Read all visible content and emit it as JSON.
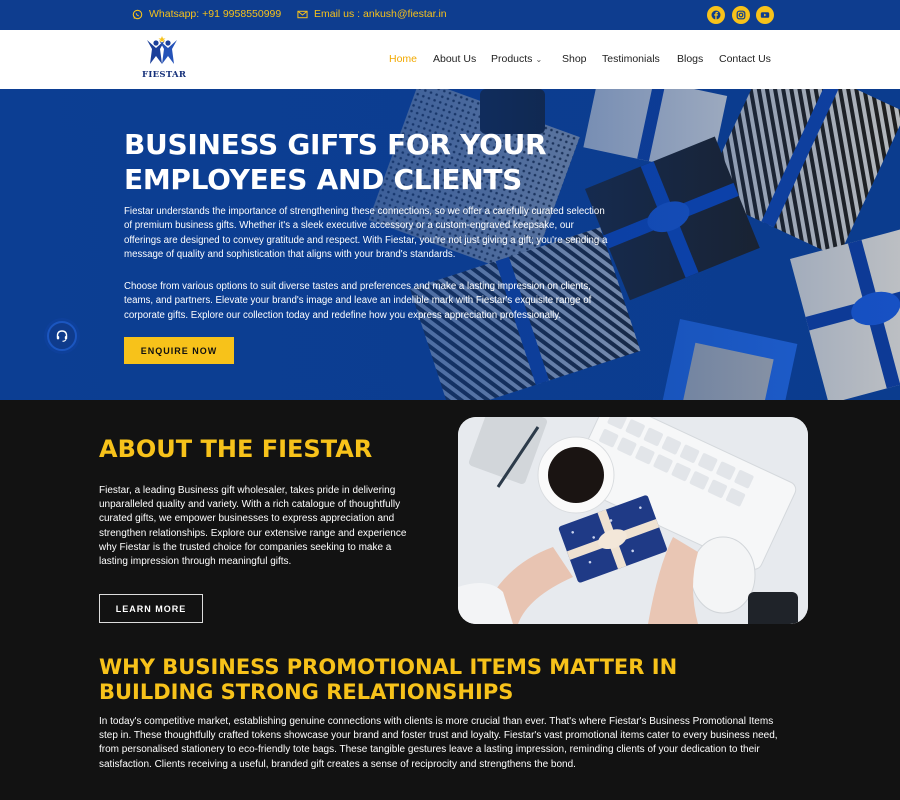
{
  "topbar": {
    "whatsapp": "Whatsapp: +91 9958550999",
    "email": "Email us : ankush@fiestar.in",
    "social_icons": [
      "facebook-icon",
      "instagram-icon",
      "youtube-icon"
    ]
  },
  "nav": {
    "logo_text": "FIESTAR",
    "items": [
      {
        "label": "Home",
        "active": true
      },
      {
        "label": "About Us"
      },
      {
        "label": "Products",
        "has_dropdown": true
      },
      {
        "label": "Shop"
      },
      {
        "label": "Testimonials"
      },
      {
        "label": "Blogs"
      },
      {
        "label": "Contact Us"
      }
    ]
  },
  "hero": {
    "title": "BUSINESS GIFTS FOR YOUR EMPLOYEES AND CLIENTS",
    "paragraph1": "Fiestar understands the importance of strengthening these connections, so we offer a carefully curated selection of premium business gifts. Whether it's a sleek executive accessory or a custom-engraved keepsake, our offerings are designed to convey gratitude and respect. With Fiestar, you're not just giving a gift; you're sending a message of quality and sophistication that aligns with your brand's standards.",
    "paragraph2": "Choose from various options to suit diverse tastes and preferences and make a lasting impression on clients, teams, and partners. Elevate your brand's image and leave an indelible mark with Fiestar's exquisite range of corporate gifts. Explore our collection today and redefine how you express appreciation professionally.",
    "cta": "ENQUIRE NOW"
  },
  "about": {
    "title": "ABOUT THE FIESTAR",
    "paragraph": "Fiestar, a leading Business gift wholesaler, takes pride in delivering unparalleled quality and variety. With a rich catalogue of thoughtfully curated gifts, we empower businesses to express appreciation and strengthen relationships. Explore our extensive range and experience why Fiestar is the trusted choice for companies seeking to make a lasting impression through meaningful gifts.",
    "cta": "LEARN MORE"
  },
  "why": {
    "title": "WHY BUSINESS PROMOTIONAL ITEMS MATTER IN BUILDING STRONG RELATIONSHIPS",
    "paragraph": "In today's competitive market, establishing genuine connections with clients is more crucial than ever. That's where Fiestar's Business Promotional Items step in. These thoughtfully crafted tokens showcase your brand and foster trust and loyalty. Fiestar's vast promotional items cater to every business need, from personalised stationery to eco-friendly tote bags. These tangible gestures leave a lasting impression, reminding clients of your dedication to their satisfaction. Clients receiving a useful, branded gift creates a sense of reciprocity and strengthens the bond."
  },
  "colors": {
    "brand_blue": "#0e3d8f",
    "accent_yellow": "#f7c21a",
    "dark_bg": "#121212"
  }
}
